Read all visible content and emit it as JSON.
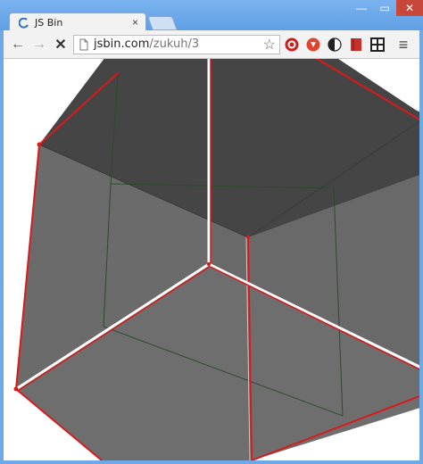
{
  "browser": {
    "tab_title": "JS Bin",
    "tab_close": "×",
    "url_host": "jsbin.com",
    "url_path": "/zukuh/3",
    "window_controls": {
      "minimize": "—",
      "maximize": "▭",
      "close": "✕"
    },
    "nav": {
      "back_icon": "←",
      "forward_icon": "→",
      "stop_icon": "✕",
      "star_icon": "☆",
      "menu_icon": "≡"
    },
    "extensions": [
      "red-circle-icon",
      "red-shield-icon",
      "half-moon-icon",
      "red-book-icon",
      "dark-grid-icon"
    ]
  },
  "scene": {
    "colors": {
      "top_face": "#454545",
      "side_face": "#6b6b6b",
      "edge_red": "#d91a1a",
      "edge_white": "#ffffff",
      "hidden_edge": "#2e4a2e"
    }
  }
}
